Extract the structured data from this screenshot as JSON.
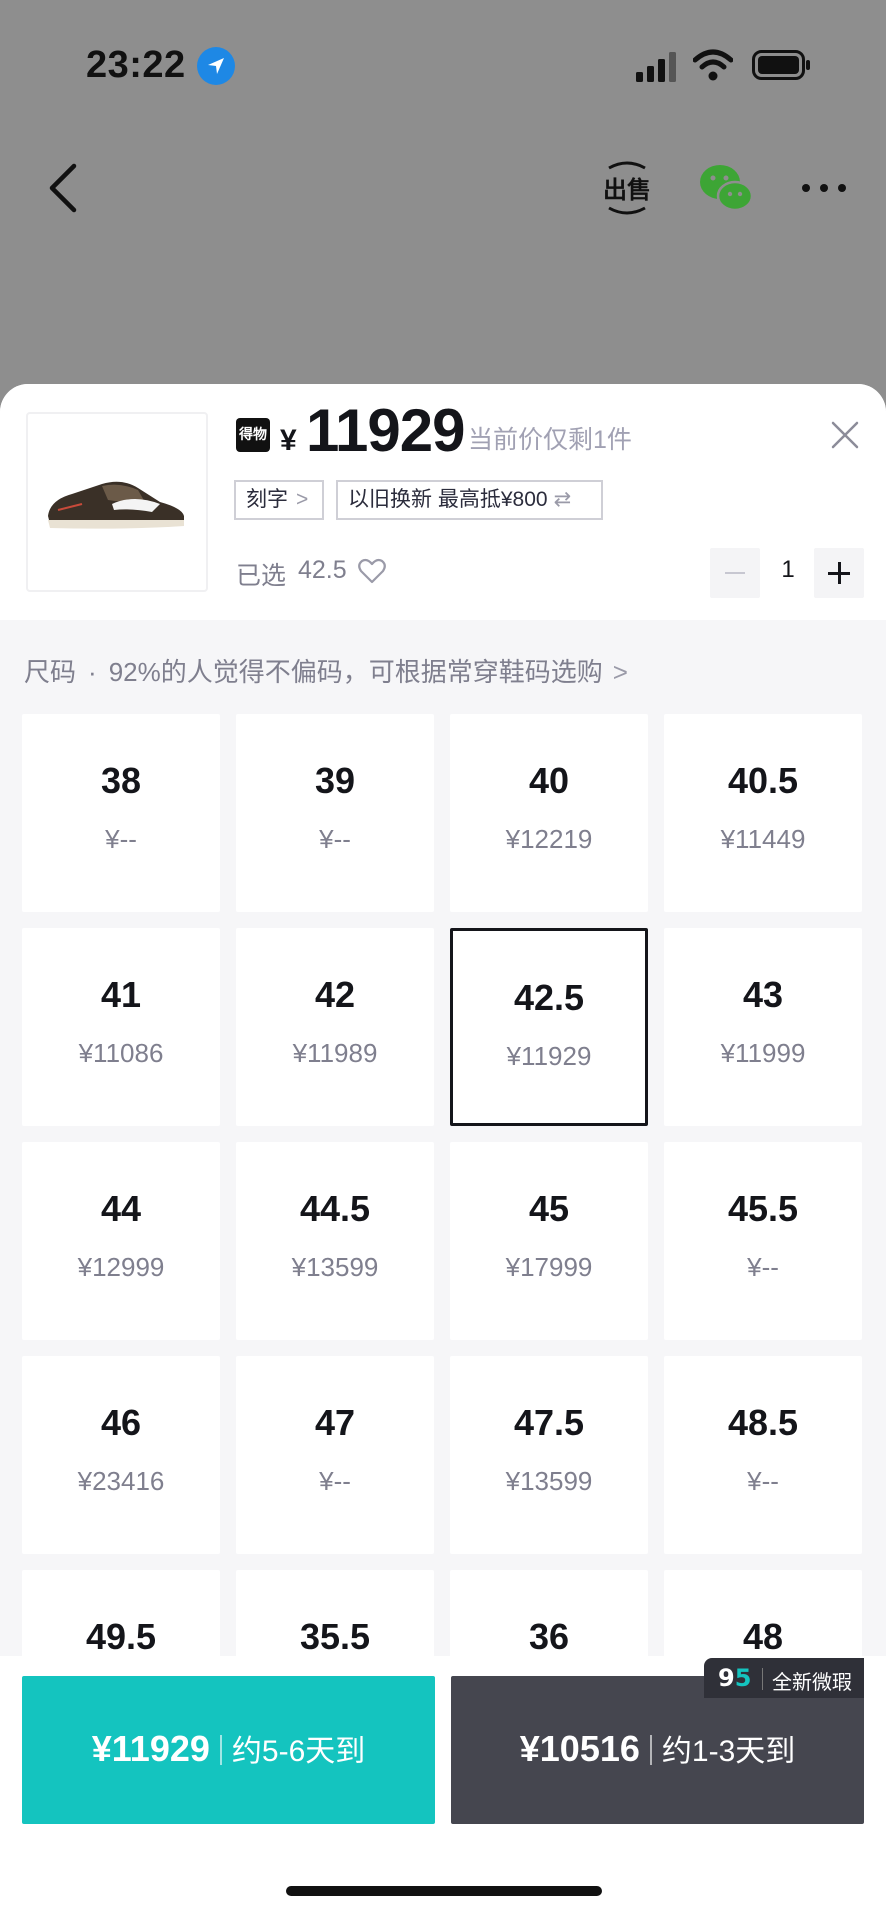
{
  "status_bar": {
    "time": "23:22"
  },
  "header": {
    "sell_label": "出售"
  },
  "product": {
    "brand_badge": "得物",
    "currency": "¥",
    "price": "11929",
    "price_note": "当前价仅剩1件",
    "tags": [
      {
        "label": "刻字",
        "suffix": ">"
      },
      {
        "label": "以旧换新 最高抵¥800",
        "suffix": "⇄"
      }
    ],
    "selected_label": "已选",
    "selected_size": "42.5",
    "quantity": "1"
  },
  "size_section": {
    "label": "尺码",
    "separator": "·",
    "hint": "92%的人觉得不偏码，可根据常穿鞋码选购",
    "chevron": ">"
  },
  "sizes": [
    {
      "size": "38",
      "price": "¥--"
    },
    {
      "size": "39",
      "price": "¥--"
    },
    {
      "size": "40",
      "price": "¥12219"
    },
    {
      "size": "40.5",
      "price": "¥11449"
    },
    {
      "size": "41",
      "price": "¥11086"
    },
    {
      "size": "42",
      "price": "¥11989"
    },
    {
      "size": "42.5",
      "price": "¥11929",
      "selected": true
    },
    {
      "size": "43",
      "price": "¥11999"
    },
    {
      "size": "44",
      "price": "¥12999"
    },
    {
      "size": "44.5",
      "price": "¥13599"
    },
    {
      "size": "45",
      "price": "¥17999"
    },
    {
      "size": "45.5",
      "price": "¥--"
    },
    {
      "size": "46",
      "price": "¥23416"
    },
    {
      "size": "47",
      "price": "¥--"
    },
    {
      "size": "47.5",
      "price": "¥13599"
    },
    {
      "size": "48.5",
      "price": "¥--"
    },
    {
      "size": "49.5",
      "price": ""
    },
    {
      "size": "35.5",
      "price": ""
    },
    {
      "size": "36",
      "price": ""
    },
    {
      "size": "48",
      "price": ""
    }
  ],
  "buy_options": [
    {
      "price": "¥11929",
      "eta": "约5-6天到",
      "color": "#14c4bf"
    },
    {
      "price": "¥10516",
      "eta": "约1-3天到",
      "color": "#45464f",
      "badge": {
        "logo_9": "9",
        "logo_5": "5",
        "text": "全新微瑕"
      }
    }
  ]
}
